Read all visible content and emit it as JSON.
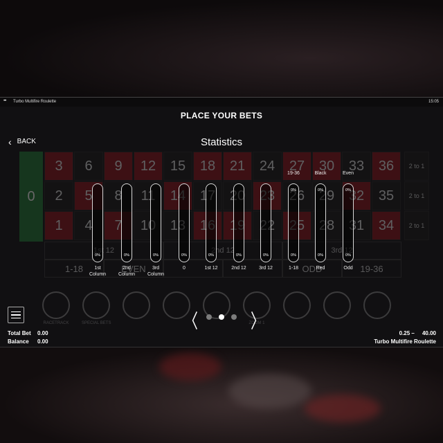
{
  "statusbar": {
    "app": "Turbo Multifire Roulette",
    "time": "15:05"
  },
  "heading": "PLACE YOUR BETS",
  "nav": {
    "back_label": "BACK",
    "title": "Statistics"
  },
  "table_bg": {
    "zero": "0",
    "rows": [
      [
        "3",
        "6",
        "9",
        "12",
        "15",
        "18",
        "21",
        "24",
        "27",
        "30",
        "33",
        "36"
      ],
      [
        "2",
        "5",
        "8",
        "11",
        "14",
        "17",
        "20",
        "23",
        "26",
        "29",
        "32",
        "35"
      ],
      [
        "1",
        "4",
        "7",
        "10",
        "13",
        "16",
        "19",
        "22",
        "25",
        "28",
        "31",
        "34"
      ]
    ],
    "column_bet": "2 to 1",
    "dozens": [
      "1st 12",
      "2nd 12",
      "3rd 12"
    ],
    "outside": [
      "1-18",
      "EVEN",
      "",
      "",
      "ODD",
      "19-36"
    ],
    "tools": [
      "RACETRACK",
      "SPECIAL BETS",
      "",
      "",
      "",
      "ZOOM 1",
      "",
      "",
      ""
    ]
  },
  "stats": [
    {
      "top_label": "",
      "top_pct": "",
      "bottom_pct": "0%",
      "label": [
        "1st",
        "Column"
      ]
    },
    {
      "top_label": "",
      "top_pct": "",
      "bottom_pct": "0%",
      "label": [
        "2nd",
        "Column"
      ]
    },
    {
      "top_label": "",
      "top_pct": "",
      "bottom_pct": "0%",
      "label": [
        "3rd",
        "Column"
      ]
    },
    {
      "top_label": "",
      "top_pct": "",
      "bottom_pct": "0%",
      "label": [
        "0",
        ""
      ]
    },
    {
      "top_label": "",
      "top_pct": "",
      "bottom_pct": "0%",
      "label": [
        "1st 12",
        ""
      ]
    },
    {
      "top_label": "",
      "top_pct": "",
      "bottom_pct": "0%",
      "label": [
        "2nd 12",
        ""
      ]
    },
    {
      "top_label": "",
      "top_pct": "",
      "bottom_pct": "0%",
      "label": [
        "3rd 12",
        ""
      ]
    },
    {
      "top_label": "19-36",
      "top_pct": "0%",
      "bottom_pct": "0%",
      "label": [
        "1-18",
        ""
      ]
    },
    {
      "top_label": "Black",
      "top_pct": "0%",
      "bottom_pct": "0%",
      "label": [
        "Red",
        ""
      ]
    },
    {
      "top_label": "Even",
      "top_pct": "0%",
      "bottom_pct": "0%",
      "label": [
        "Odd",
        ""
      ]
    }
  ],
  "pager": {
    "prev": "〈",
    "next": "〉",
    "pages": 3,
    "active_index": 1
  },
  "footer": {
    "total_bet_label": "Total Bet",
    "total_bet_value": "0.00",
    "balance_label": "Balance",
    "balance_value": "0.00",
    "limits": "0.25 –     40.00",
    "game_name": "Turbo Multifire Roulette"
  },
  "colors": {
    "red": "#7a1018",
    "green": "#1e6b30",
    "track_border": "#d8d8d8",
    "dot_active": "#ffffff",
    "dot_inactive": "#7c7c7c"
  }
}
